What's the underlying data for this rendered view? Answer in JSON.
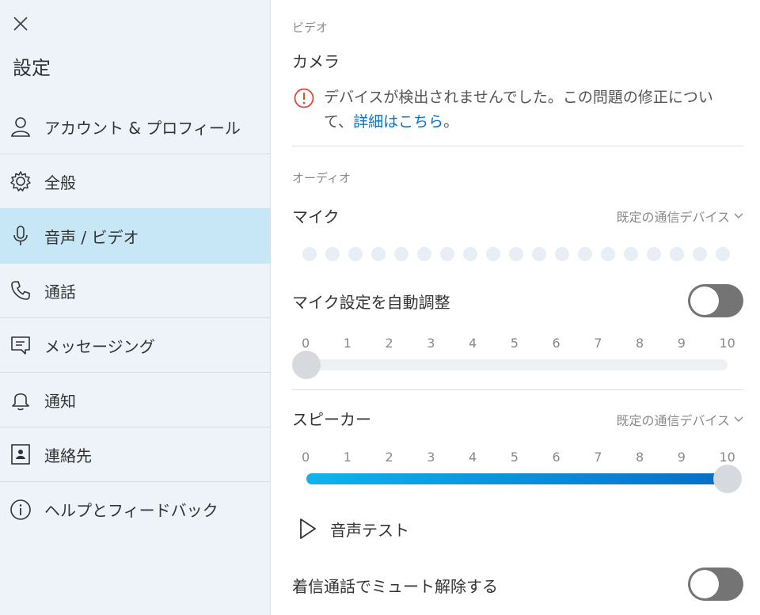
{
  "sidebar": {
    "title": "設定",
    "items": [
      {
        "label": "アカウント & プロフィール",
        "icon": "person-icon"
      },
      {
        "label": "全般",
        "icon": "gear-icon"
      },
      {
        "label": "音声 / ビデオ",
        "icon": "microphone-icon",
        "active": true
      },
      {
        "label": "通話",
        "icon": "phone-icon"
      },
      {
        "label": "メッセージング",
        "icon": "message-icon"
      },
      {
        "label": "通知",
        "icon": "bell-icon"
      },
      {
        "label": "連絡先",
        "icon": "contact-card-icon"
      },
      {
        "label": "ヘルプとフィードバック",
        "icon": "info-icon"
      }
    ]
  },
  "video": {
    "section_label": "ビデオ",
    "camera_title": "カメラ",
    "error_text": "デバイスが検出されませんでした。この問題の修正について、",
    "error_link": "詳細はこちら",
    "error_suffix": "。"
  },
  "audio": {
    "section_label": "オーディオ",
    "mic_title": "マイク",
    "mic_device": "既定の通信デバイス",
    "mic_level_dots": 19,
    "auto_adjust_label": "マイク設定を自動調整",
    "auto_adjust_on": false,
    "mic_volume_ticks": [
      "0",
      "1",
      "2",
      "3",
      "4",
      "5",
      "6",
      "7",
      "8",
      "9",
      "10"
    ],
    "mic_volume": 0,
    "speaker_title": "スピーカー",
    "speaker_device": "既定の通信デバイス",
    "speaker_volume_ticks": [
      "0",
      "1",
      "2",
      "3",
      "4",
      "5",
      "6",
      "7",
      "8",
      "9",
      "10"
    ],
    "speaker_volume": 10,
    "test_label": "音声テスト",
    "unmute_label": "着信通話でミュート解除する",
    "unmute_on": false
  },
  "colors": {
    "sidebar_bg": "#eef3fa",
    "active_bg": "#c7e6f6",
    "link": "#0a73c4",
    "error": "#e0483e",
    "slider_start": "#10b3ea",
    "slider_end": "#0a6dc4"
  }
}
